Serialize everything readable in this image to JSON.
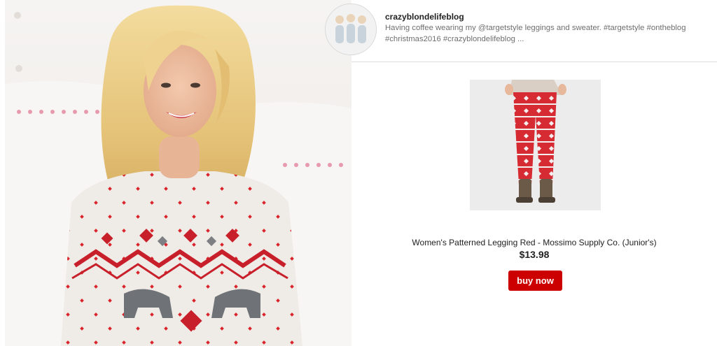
{
  "post": {
    "username": "crazyblondelifeblog",
    "caption": "Having coffee wearing my @targetstyle leggings and sweater. #targetstyle #ontheblog #christmas2016 #crazyblondelifeblog ..."
  },
  "product": {
    "title": "Women's Patterned Legging Red - Mossimo Supply Co. (Junior's)",
    "price": "$13.98",
    "buy_label": "buy now"
  },
  "colors": {
    "accent_red": "#cc0000",
    "text_dark": "#222222",
    "text_muted": "#6f6f6f",
    "divider": "#dcdcdc"
  },
  "icons": []
}
